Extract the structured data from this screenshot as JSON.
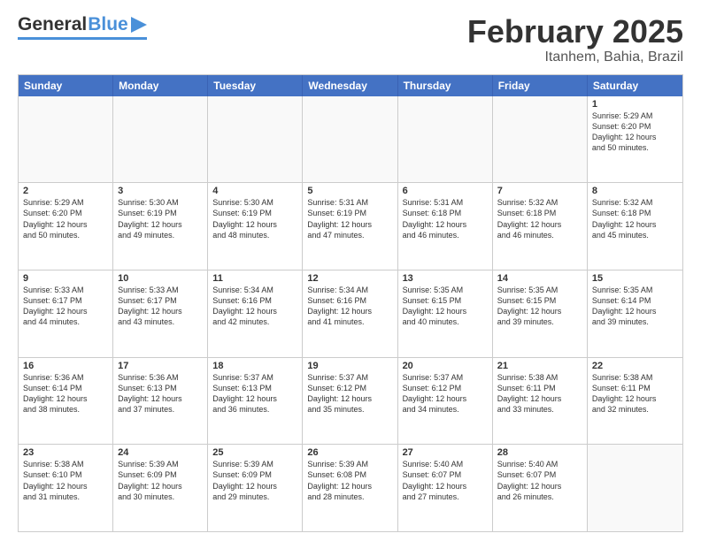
{
  "logo": {
    "general": "General",
    "blue": "Blue"
  },
  "header": {
    "month": "February 2025",
    "location": "Itanhem, Bahia, Brazil"
  },
  "days": [
    "Sunday",
    "Monday",
    "Tuesday",
    "Wednesday",
    "Thursday",
    "Friday",
    "Saturday"
  ],
  "weeks": [
    [
      {
        "day": "",
        "info": ""
      },
      {
        "day": "",
        "info": ""
      },
      {
        "day": "",
        "info": ""
      },
      {
        "day": "",
        "info": ""
      },
      {
        "day": "",
        "info": ""
      },
      {
        "day": "",
        "info": ""
      },
      {
        "day": "1",
        "info": "Sunrise: 5:29 AM\nSunset: 6:20 PM\nDaylight: 12 hours\nand 50 minutes."
      }
    ],
    [
      {
        "day": "2",
        "info": "Sunrise: 5:29 AM\nSunset: 6:20 PM\nDaylight: 12 hours\nand 50 minutes."
      },
      {
        "day": "3",
        "info": "Sunrise: 5:30 AM\nSunset: 6:19 PM\nDaylight: 12 hours\nand 49 minutes."
      },
      {
        "day": "4",
        "info": "Sunrise: 5:30 AM\nSunset: 6:19 PM\nDaylight: 12 hours\nand 48 minutes."
      },
      {
        "day": "5",
        "info": "Sunrise: 5:31 AM\nSunset: 6:19 PM\nDaylight: 12 hours\nand 47 minutes."
      },
      {
        "day": "6",
        "info": "Sunrise: 5:31 AM\nSunset: 6:18 PM\nDaylight: 12 hours\nand 46 minutes."
      },
      {
        "day": "7",
        "info": "Sunrise: 5:32 AM\nSunset: 6:18 PM\nDaylight: 12 hours\nand 46 minutes."
      },
      {
        "day": "8",
        "info": "Sunrise: 5:32 AM\nSunset: 6:18 PM\nDaylight: 12 hours\nand 45 minutes."
      }
    ],
    [
      {
        "day": "9",
        "info": "Sunrise: 5:33 AM\nSunset: 6:17 PM\nDaylight: 12 hours\nand 44 minutes."
      },
      {
        "day": "10",
        "info": "Sunrise: 5:33 AM\nSunset: 6:17 PM\nDaylight: 12 hours\nand 43 minutes."
      },
      {
        "day": "11",
        "info": "Sunrise: 5:34 AM\nSunset: 6:16 PM\nDaylight: 12 hours\nand 42 minutes."
      },
      {
        "day": "12",
        "info": "Sunrise: 5:34 AM\nSunset: 6:16 PM\nDaylight: 12 hours\nand 41 minutes."
      },
      {
        "day": "13",
        "info": "Sunrise: 5:35 AM\nSunset: 6:15 PM\nDaylight: 12 hours\nand 40 minutes."
      },
      {
        "day": "14",
        "info": "Sunrise: 5:35 AM\nSunset: 6:15 PM\nDaylight: 12 hours\nand 39 minutes."
      },
      {
        "day": "15",
        "info": "Sunrise: 5:35 AM\nSunset: 6:14 PM\nDaylight: 12 hours\nand 39 minutes."
      }
    ],
    [
      {
        "day": "16",
        "info": "Sunrise: 5:36 AM\nSunset: 6:14 PM\nDaylight: 12 hours\nand 38 minutes."
      },
      {
        "day": "17",
        "info": "Sunrise: 5:36 AM\nSunset: 6:13 PM\nDaylight: 12 hours\nand 37 minutes."
      },
      {
        "day": "18",
        "info": "Sunrise: 5:37 AM\nSunset: 6:13 PM\nDaylight: 12 hours\nand 36 minutes."
      },
      {
        "day": "19",
        "info": "Sunrise: 5:37 AM\nSunset: 6:12 PM\nDaylight: 12 hours\nand 35 minutes."
      },
      {
        "day": "20",
        "info": "Sunrise: 5:37 AM\nSunset: 6:12 PM\nDaylight: 12 hours\nand 34 minutes."
      },
      {
        "day": "21",
        "info": "Sunrise: 5:38 AM\nSunset: 6:11 PM\nDaylight: 12 hours\nand 33 minutes."
      },
      {
        "day": "22",
        "info": "Sunrise: 5:38 AM\nSunset: 6:11 PM\nDaylight: 12 hours\nand 32 minutes."
      }
    ],
    [
      {
        "day": "23",
        "info": "Sunrise: 5:38 AM\nSunset: 6:10 PM\nDaylight: 12 hours\nand 31 minutes."
      },
      {
        "day": "24",
        "info": "Sunrise: 5:39 AM\nSunset: 6:09 PM\nDaylight: 12 hours\nand 30 minutes."
      },
      {
        "day": "25",
        "info": "Sunrise: 5:39 AM\nSunset: 6:09 PM\nDaylight: 12 hours\nand 29 minutes."
      },
      {
        "day": "26",
        "info": "Sunrise: 5:39 AM\nSunset: 6:08 PM\nDaylight: 12 hours\nand 28 minutes."
      },
      {
        "day": "27",
        "info": "Sunrise: 5:40 AM\nSunset: 6:07 PM\nDaylight: 12 hours\nand 27 minutes."
      },
      {
        "day": "28",
        "info": "Sunrise: 5:40 AM\nSunset: 6:07 PM\nDaylight: 12 hours\nand 26 minutes."
      },
      {
        "day": "",
        "info": ""
      }
    ]
  ]
}
